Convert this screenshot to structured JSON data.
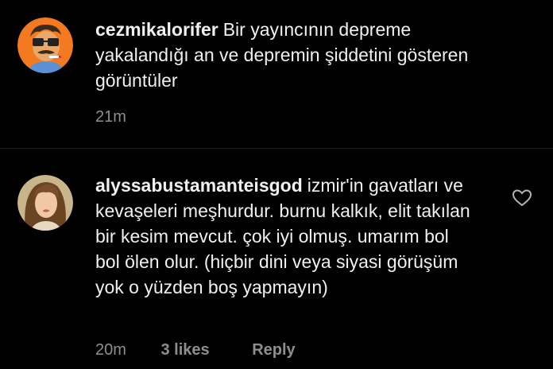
{
  "comments": [
    {
      "username": "cezmikalorifer",
      "text": "Bir yayıncının depreme yakalandığı an ve depremin şiddetini gösteren görüntüler",
      "time": "21m",
      "avatar_icon": "cartoon-man-avatar"
    },
    {
      "username": "alyssabustamanteisgod",
      "text": "izmir'in gavatları ve kevaşeleri meşhurdur. burnu kalkık, elit takılan bir kesim mevcut. çok iyi olmuş. umarım bol bol ölen olur. (hiçbir dini veya siyasi görüşüm yok o yüzden boş yapmayın)",
      "time": "20m",
      "likes": "3 likes",
      "reply_label": "Reply",
      "avatar_icon": "woman-photo-avatar",
      "like_icon": "heart-outline-icon"
    }
  ],
  "colors": {
    "background": "#000000",
    "text": "#f0f0f0",
    "meta": "#8e8e8e",
    "avatar_orange": "#f47a1f"
  }
}
